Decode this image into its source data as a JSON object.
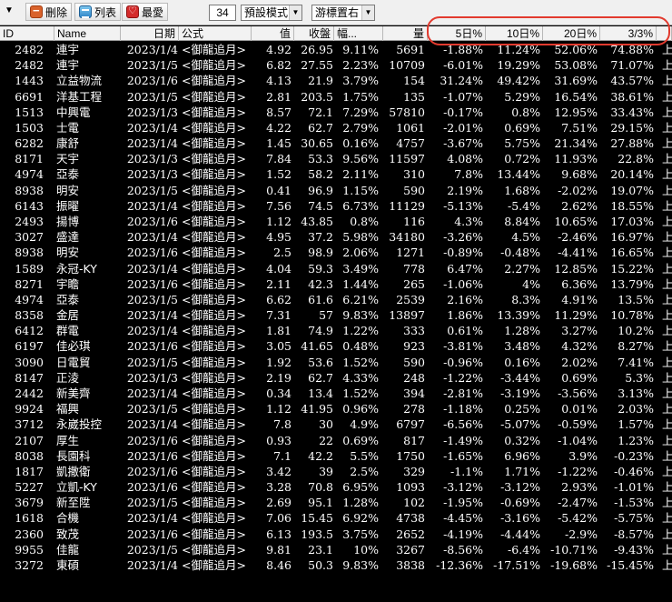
{
  "toolbar": {
    "delete_label": "刪除",
    "list_label": "列表",
    "favorite_label": "最愛",
    "count_value": "34",
    "mode_select": "預設模式",
    "cursor_select": "游標置右"
  },
  "columns": [
    "ID",
    "Name",
    "日期",
    "公式",
    "值",
    "收盤",
    "幅...",
    "量",
    "5日%",
    "10日%",
    "20日%",
    "3/3%",
    ""
  ],
  "rows": [
    [
      "2482",
      "連宇",
      "2023/1/4",
      "<御龍追月>",
      "4.92",
      "26.95",
      "9.11%",
      "5691",
      "-1.88%",
      "11.24%",
      "52.06%",
      "74.88%",
      "上"
    ],
    [
      "2482",
      "連宇",
      "2023/1/5",
      "<御龍追月>",
      "6.82",
      "27.55",
      "2.23%",
      "10709",
      "-6.01%",
      "19.29%",
      "53.08%",
      "71.07%",
      "上"
    ],
    [
      "1443",
      "立益物流",
      "2023/1/6",
      "<御龍追月>",
      "4.13",
      "21.9",
      "3.79%",
      "154",
      "31.24%",
      "49.42%",
      "31.69%",
      "43.57%",
      "上"
    ],
    [
      "6691",
      "洋基工程",
      "2023/1/5",
      "<御龍追月>",
      "2.81",
      "203.5",
      "1.75%",
      "135",
      "-1.07%",
      "5.29%",
      "16.54%",
      "38.61%",
      "上"
    ],
    [
      "1513",
      "中興電",
      "2023/1/3",
      "<御龍追月>",
      "8.57",
      "72.1",
      "7.29%",
      "57810",
      "-0.17%",
      "0.8%",
      "12.95%",
      "33.43%",
      "上"
    ],
    [
      "1503",
      "士電",
      "2023/1/4",
      "<御龍追月>",
      "4.22",
      "62.7",
      "2.79%",
      "1061",
      "-2.01%",
      "0.69%",
      "7.51%",
      "29.15%",
      "上"
    ],
    [
      "6282",
      "康舒",
      "2023/1/4",
      "<御龍追月>",
      "1.45",
      "30.65",
      "0.16%",
      "4757",
      "-3.67%",
      "5.75%",
      "21.34%",
      "27.88%",
      "上"
    ],
    [
      "8171",
      "天宇",
      "2023/1/3",
      "<御龍追月>",
      "7.84",
      "53.3",
      "9.56%",
      "11597",
      "4.08%",
      "0.72%",
      "11.93%",
      "22.8%",
      "上"
    ],
    [
      "4974",
      "亞泰",
      "2023/1/3",
      "<御龍追月>",
      "1.52",
      "58.2",
      "2.11%",
      "310",
      "7.8%",
      "13.44%",
      "9.68%",
      "20.14%",
      "上"
    ],
    [
      "8938",
      "明安",
      "2023/1/5",
      "<御龍追月>",
      "0.41",
      "96.9",
      "1.15%",
      "590",
      "2.19%",
      "1.68%",
      "-2.02%",
      "19.07%",
      "上"
    ],
    [
      "6143",
      "振曜",
      "2023/1/4",
      "<御龍追月>",
      "7.56",
      "74.5",
      "6.73%",
      "11129",
      "-5.13%",
      "-5.4%",
      "2.62%",
      "18.55%",
      "上"
    ],
    [
      "2493",
      "揚博",
      "2023/1/6",
      "<御龍追月>",
      "1.12",
      "43.85",
      "0.8%",
      "116",
      "4.3%",
      "8.84%",
      "10.65%",
      "17.03%",
      "上"
    ],
    [
      "3027",
      "盛達",
      "2023/1/4",
      "<御龍追月>",
      "4.95",
      "37.2",
      "5.98%",
      "34180",
      "-3.26%",
      "4.5%",
      "-2.46%",
      "16.97%",
      "上"
    ],
    [
      "8938",
      "明安",
      "2023/1/6",
      "<御龍追月>",
      "2.5",
      "98.9",
      "2.06%",
      "1271",
      "-0.89%",
      "-0.48%",
      "-4.41%",
      "16.65%",
      "上"
    ],
    [
      "1589",
      "永冠-KY",
      "2023/1/4",
      "<御龍追月>",
      "4.04",
      "59.3",
      "3.49%",
      "778",
      "6.47%",
      "2.27%",
      "12.85%",
      "15.22%",
      "上"
    ],
    [
      "8271",
      "宇瞻",
      "2023/1/6",
      "<御龍追月>",
      "2.11",
      "42.3",
      "1.44%",
      "265",
      "-1.06%",
      "4%",
      "6.36%",
      "13.79%",
      "上"
    ],
    [
      "4974",
      "亞泰",
      "2023/1/5",
      "<御龍追月>",
      "6.62",
      "61.6",
      "6.21%",
      "2539",
      "2.16%",
      "8.3%",
      "4.91%",
      "13.5%",
      "上"
    ],
    [
      "8358",
      "金居",
      "2023/1/4",
      "<御龍追月>",
      "7.31",
      "57",
      "9.83%",
      "13897",
      "1.86%",
      "13.39%",
      "11.29%",
      "10.78%",
      "上"
    ],
    [
      "6412",
      "群電",
      "2023/1/4",
      "<御龍追月>",
      "1.81",
      "74.9",
      "1.22%",
      "333",
      "0.61%",
      "1.28%",
      "3.27%",
      "10.2%",
      "上"
    ],
    [
      "6197",
      "佳必琪",
      "2023/1/6",
      "<御龍追月>",
      "3.05",
      "41.65",
      "0.48%",
      "923",
      "-3.81%",
      "3.48%",
      "4.32%",
      "8.27%",
      "上"
    ],
    [
      "3090",
      "日電貿",
      "2023/1/5",
      "<御龍追月>",
      "1.92",
      "53.6",
      "1.52%",
      "590",
      "-0.96%",
      "0.16%",
      "2.02%",
      "7.41%",
      "上"
    ],
    [
      "8147",
      "正淩",
      "2023/1/3",
      "<御龍追月>",
      "2.19",
      "62.7",
      "4.33%",
      "248",
      "-1.22%",
      "-3.44%",
      "0.69%",
      "5.3%",
      "上"
    ],
    [
      "2442",
      "新美齊",
      "2023/1/4",
      "<御龍追月>",
      "0.34",
      "13.4",
      "1.52%",
      "394",
      "-2.81%",
      "-3.19%",
      "-3.56%",
      "3.13%",
      "上"
    ],
    [
      "9924",
      "福興",
      "2023/1/5",
      "<御龍追月>",
      "1.12",
      "41.95",
      "0.96%",
      "278",
      "-1.18%",
      "0.25%",
      "0.01%",
      "2.03%",
      "上"
    ],
    [
      "3712",
      "永崴投控",
      "2023/1/4",
      "<御龍追月>",
      "7.8",
      "30",
      "4.9%",
      "6797",
      "-6.56%",
      "-5.07%",
      "-0.59%",
      "1.57%",
      "上"
    ],
    [
      "2107",
      "厚生",
      "2023/1/6",
      "<御龍追月>",
      "0.93",
      "22",
      "0.69%",
      "817",
      "-1.49%",
      "0.32%",
      "-1.04%",
      "1.23%",
      "上"
    ],
    [
      "8038",
      "長園科",
      "2023/1/6",
      "<御龍追月>",
      "7.1",
      "42.2",
      "5.5%",
      "1750",
      "-1.65%",
      "6.96%",
      "3.9%",
      "-0.23%",
      "上"
    ],
    [
      "1817",
      "凱撒衛",
      "2023/1/6",
      "<御龍追月>",
      "3.42",
      "39",
      "2.5%",
      "329",
      "-1.1%",
      "1.71%",
      "-1.22%",
      "-0.46%",
      "上"
    ],
    [
      "5227",
      "立凱-KY",
      "2023/1/6",
      "<御龍追月>",
      "3.28",
      "70.8",
      "6.95%",
      "1093",
      "-3.12%",
      "-3.12%",
      "2.93%",
      "-1.01%",
      "上"
    ],
    [
      "3679",
      "新至陞",
      "2023/1/5",
      "<御龍追月>",
      "2.69",
      "95.1",
      "1.28%",
      "102",
      "-1.95%",
      "-0.69%",
      "-2.47%",
      "-1.53%",
      "上"
    ],
    [
      "1618",
      "合機",
      "2023/1/4",
      "<御龍追月>",
      "7.06",
      "15.45",
      "6.92%",
      "4738",
      "-4.45%",
      "-3.16%",
      "-5.42%",
      "-5.75%",
      "上"
    ],
    [
      "2360",
      "致茂",
      "2023/1/6",
      "<御龍追月>",
      "6.13",
      "193.5",
      "3.75%",
      "2652",
      "-4.19%",
      "-4.44%",
      "-2.9%",
      "-8.57%",
      "上"
    ],
    [
      "9955",
      "佳龍",
      "2023/1/5",
      "<御龍追月>",
      "9.81",
      "23.1",
      "10%",
      "3267",
      "-8.56%",
      "-6.4%",
      "-10.71%",
      "-9.43%",
      "上"
    ],
    [
      "3272",
      "東碩",
      "2023/1/4",
      "<御龍追月>",
      "8.46",
      "50.3",
      "9.83%",
      "3838",
      "-12.36%",
      "-17.51%",
      "-19.68%",
      "-15.45%",
      "上"
    ]
  ]
}
